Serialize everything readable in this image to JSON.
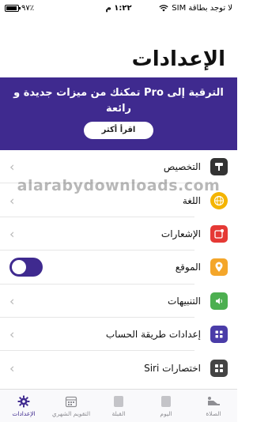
{
  "status_bar": {
    "battery_label": "٩٧٪",
    "time": "١:٢٢ م",
    "carrier": "لا توجد بطاقة SIM"
  },
  "page_title": "الإعدادات",
  "promo": {
    "text": "الترقية إلى Pro تمكنك من ميزات جديدة و رائعة",
    "button": "اقرأ أكثر"
  },
  "watermark": "alarabydownloads.com",
  "settings": [
    {
      "label": "التخصيص",
      "icon": "paint-roller-icon",
      "color": "#333333",
      "control": "chevron"
    },
    {
      "label": "اللغة",
      "icon": "globe-icon",
      "color": "#f4b400",
      "control": "chevron"
    },
    {
      "label": "الإشعارات",
      "icon": "notification-icon",
      "color": "#e53935",
      "control": "chevron"
    },
    {
      "label": "الموقع",
      "icon": "location-pin-icon",
      "color": "#f4a62a",
      "control": "toggle",
      "toggle_on": true
    },
    {
      "label": "التنبيهات",
      "icon": "speaker-icon",
      "color": "#4caf50",
      "control": "chevron"
    },
    {
      "label": "إعدادات طريقة الحساب",
      "icon": "calculator-icon",
      "color": "#4a3ca8",
      "control": "chevron"
    },
    {
      "label": "اختصارات Siri",
      "icon": "grid-icon",
      "color": "#444444",
      "control": "chevron"
    }
  ],
  "tabs": [
    {
      "label": "الصلاة",
      "icon": "prayer-icon",
      "active": false
    },
    {
      "label": "اليوم",
      "icon": "today-icon",
      "active": false
    },
    {
      "label": "القبلة",
      "icon": "qibla-icon",
      "active": false
    },
    {
      "label": "التقويم الشهري",
      "icon": "calendar-icon",
      "active": false
    },
    {
      "label": "الإعدادات",
      "icon": "gear-icon",
      "active": true
    }
  ],
  "colors": {
    "accent": "#3f2a8f"
  }
}
